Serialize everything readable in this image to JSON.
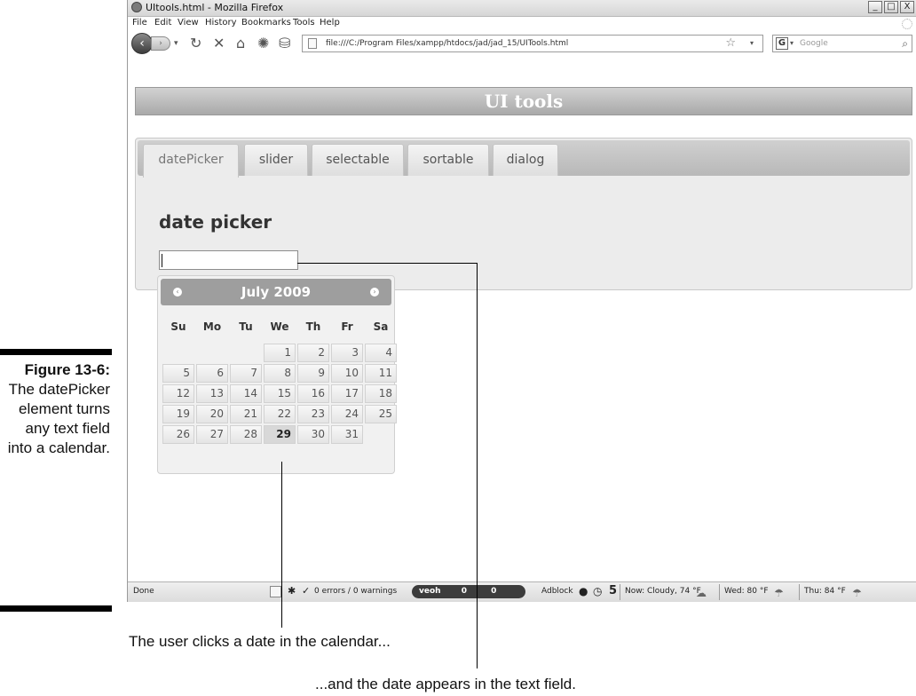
{
  "figure": {
    "number": "Figure 13-6:",
    "caption": "The datePicker element turns any text field into a calendar.",
    "callout_calendar": "The user clicks a date in the calendar...",
    "callout_field": "...and the date appears in the text field."
  },
  "browser": {
    "title": "UItools.html - Mozilla Firefox",
    "menu": [
      "File",
      "Edit",
      "View",
      "History",
      "Bookmarks",
      "Tools",
      "Help"
    ],
    "url": "file:///C:/Program Files/xampp/htdocs/jad/jad_15/UITools.html",
    "search_placeholder": "Google",
    "search_engine_icon": "G",
    "window_buttons": [
      "_",
      "□",
      "X"
    ]
  },
  "page": {
    "header": "UI tools",
    "tabs": [
      {
        "label": "datePicker",
        "active": true
      },
      {
        "label": "slider",
        "active": false
      },
      {
        "label": "selectable",
        "active": false
      },
      {
        "label": "sortable",
        "active": false
      },
      {
        "label": "dialog",
        "active": false
      }
    ],
    "panel_title": "date picker",
    "date_input_value": ""
  },
  "calendar": {
    "month_label": "July 2009",
    "prev_label": "‹",
    "next_label": "›",
    "weekdays": [
      "Su",
      "Mo",
      "Tu",
      "We",
      "Th",
      "Fr",
      "Sa"
    ],
    "first_weekday_index": 3,
    "days_in_month": 31,
    "highlighted_day": 29
  },
  "status": {
    "left": "Done",
    "errors": "0 errors / 0 warnings",
    "veoh": "veoh",
    "veoh_counts": [
      "0",
      "0"
    ],
    "adblock": "Adblock",
    "number": "5",
    "now": "Now: Cloudy, 74 °F",
    "wed": "Wed: 80 °F",
    "thu": "Thu: 84 °F"
  },
  "colors": {
    "header_gradient": "#a9a9a9",
    "calendar_header": "#9e9e9e",
    "highlight_day": "#d8d8d8"
  }
}
